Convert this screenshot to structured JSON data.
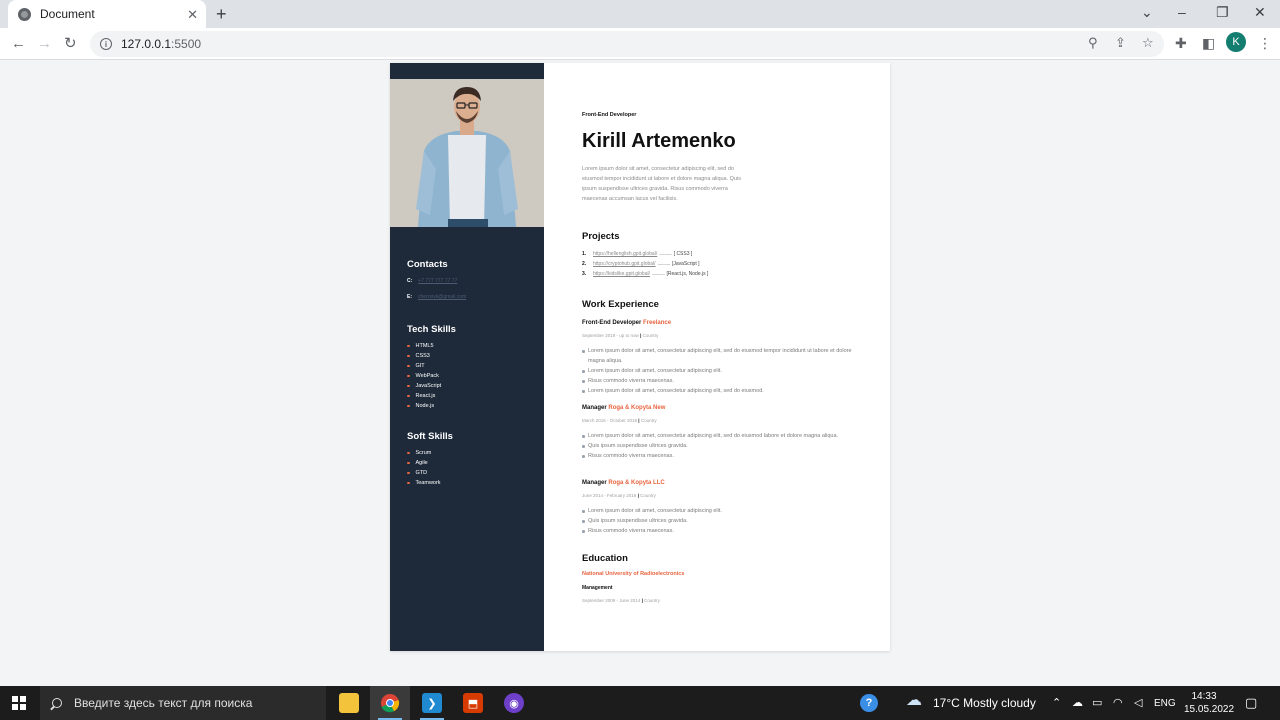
{
  "browser": {
    "tab_title": "Document",
    "url_host": "127.0.0.1",
    "url_port": ":5500",
    "profile_initial": "K"
  },
  "resume": {
    "subtitle": "Front-End Developer",
    "name": "Kirill Artemenko",
    "about": "Lorem ipsum dolor sit amet, consectetur adipiscing elit, sed do eiusmod tempor incididunt ut labore et dolore magna aliqua. Quis ipsum suspendisse ultrices gravida. Risus commodo viverra maecenas accumsan lacus vel facilisis.",
    "sidebar": {
      "contacts_heading": "Contacts",
      "contacts": [
        {
          "key": "C:",
          "value": "+7 777 777 77 77"
        },
        {
          "key": "E:",
          "value": "chernovk@gmail.com"
        }
      ],
      "tech_heading": "Tech Skills",
      "tech_skills": [
        "HTML5",
        "CSS3",
        "GIT",
        "WebPack",
        "JavaScript",
        "React.js",
        "Node.js"
      ],
      "soft_heading": "Soft Skills",
      "soft_skills": [
        "Scrum",
        "Agile",
        "GTD",
        "Teamwork"
      ]
    },
    "projects_heading": "Projects",
    "projects": [
      {
        "num": "1.",
        "url": "https://hellenglish.gpit.global/",
        "dots": "..............",
        "tech": "[ CSS3 ]"
      },
      {
        "num": "2.",
        "url": "https://cryptohub.gpit.global/",
        "dots": "..............",
        "tech": "[JavaScript ]"
      },
      {
        "num": "3.",
        "url": "https://kidslike.gpit.global/",
        "dots": "..............",
        "tech": "[React.js, Node.js ]"
      }
    ],
    "work_heading": "Work Experience",
    "jobs": [
      {
        "title": "Front-End Developer",
        "company": "Freelance",
        "dates": "September 2019 - up to now",
        "sep": "|",
        "location": "Country",
        "bullets": [
          "Lorem ipsum dolor sit amet, consectetur adipiscing elit, sed do eiusmod tempor incididunt ut labore et dolore magna aliqua.",
          "Lorem ipsum dolor sit amet, consectetur adipiscing elit.",
          "Risus commodo viverra maecenas.",
          "Lorem ipsum dolor sit amet, consectetur adipiscing elit, sed do eiusmod."
        ]
      },
      {
        "title": "Manager",
        "company": "Roga & Kopyta New",
        "dates": "March 2016 - October 2018",
        "sep": "|",
        "location": "Country",
        "bullets": [
          "Lorem ipsum dolor sit amet, consectetur adipiscing elit, sed do eiusmod labore et dolore magna aliqua.",
          "Quis ipsum suspendisse ultrices gravida.",
          "Risus commodo viverra maecenas."
        ]
      },
      {
        "title": "Manager",
        "company": "Roga & Kopyta LLC",
        "dates": "June 2014 - February 2016",
        "sep": "|",
        "location": "Country",
        "bullets": [
          "Lorem ipsum dolor sit amet, consectetur adipiscing elit.",
          "Quis ipsum suspendisse ultrices gravida.",
          "Risus commodo viverra maecenas."
        ]
      }
    ],
    "education_heading": "Education",
    "education": {
      "university": "National University of Radioelectronics",
      "faculty": "Management",
      "dates": "September 2009 - June 2014",
      "sep": "|",
      "location": "Country"
    }
  },
  "taskbar": {
    "search_placeholder": "Введите здесь текст для поиска",
    "weather": "17°C  Mostly cloudy",
    "language": "ENG",
    "time": "14:33",
    "date": "15.05.2022"
  },
  "colors": {
    "sidebar_bg": "#1e2a3a",
    "accent": "#e8643f"
  }
}
